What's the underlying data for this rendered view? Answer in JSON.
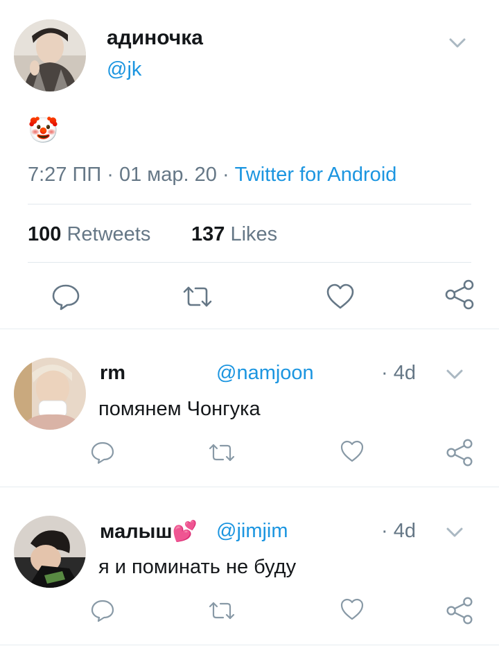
{
  "main_tweet": {
    "display_name": "адиночка",
    "handle": "@jk",
    "body_emoji": "🤡",
    "time": "7:27 ПП",
    "dot1": "·",
    "date": "01 мар. 20",
    "dot2": "·",
    "source": "Twitter for Android",
    "retweets_count": "100",
    "retweets_label": "Retweets",
    "likes_count": "137",
    "likes_label": "Likes"
  },
  "replies": [
    {
      "display_name": "rm",
      "handle": "@namjoon",
      "time": "· 4d",
      "text": "помянем Чонгука"
    },
    {
      "display_name": "малыш💕",
      "handle": "@jimjim",
      "time": "· 4d",
      "text": "я и поминать не буду"
    }
  ],
  "colors": {
    "link": "#1b95e0",
    "secondary": "#657786",
    "primary": "#14171a",
    "divider": "#e1e8ed"
  },
  "icons": [
    "chevron-down-icon",
    "reply-icon",
    "retweet-icon",
    "like-icon",
    "share-icon"
  ]
}
